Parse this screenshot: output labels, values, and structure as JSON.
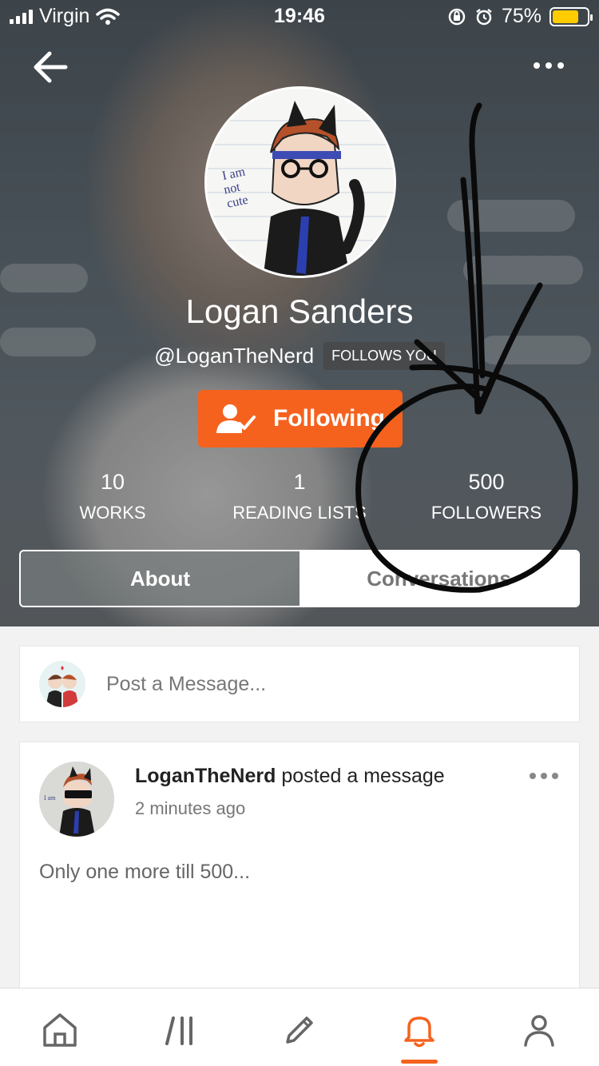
{
  "status_bar": {
    "carrier": "Virgin",
    "time": "19:46",
    "battery_percent": "75%",
    "battery_level": 0.75,
    "icons": [
      "signal-icon",
      "wifi-icon",
      "orientation-lock-icon",
      "alarm-icon",
      "battery-icon"
    ]
  },
  "header": {
    "back_icon": "arrow-left-icon",
    "more_icon": "more-horizontal-icon"
  },
  "profile": {
    "name": "Logan Sanders",
    "handle": "@LoganTheNerd",
    "follows_badge": "FOLLOWS YOU",
    "follow_button": "Following",
    "follow_icon": "user-check-icon"
  },
  "stats": [
    {
      "value": "10",
      "label": "WORKS"
    },
    {
      "value": "1",
      "label": "READING LISTS"
    },
    {
      "value": "500",
      "label": "FOLLOWERS"
    }
  ],
  "tabs": [
    {
      "label": "About",
      "active": true
    },
    {
      "label": "Conversations",
      "active": false
    }
  ],
  "post_box": {
    "placeholder": "Post a Message..."
  },
  "message": {
    "author": "LoganTheNerd",
    "action": "posted a message",
    "time": "2 minutes ago",
    "body": "Only one more till 500..."
  },
  "bottom_nav": {
    "items": [
      "home-icon",
      "library-icon",
      "write-icon",
      "notifications-icon",
      "profile-icon"
    ],
    "active": "notifications-icon"
  },
  "colors": {
    "accent": "#f5621e",
    "battery": "#ffcc00"
  }
}
